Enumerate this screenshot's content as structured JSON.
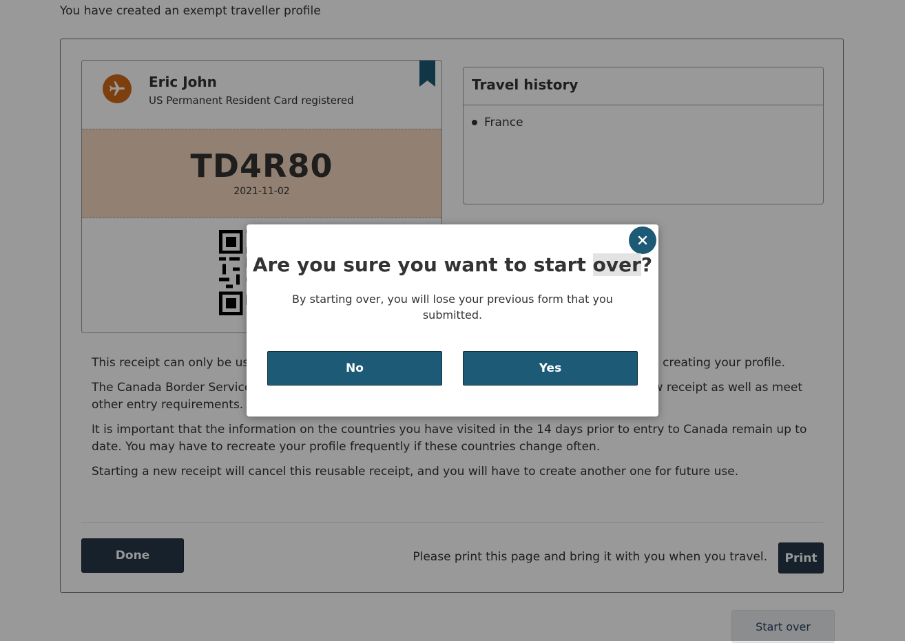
{
  "page": {
    "intro_text": "You have created an exempt traveller profile"
  },
  "receipt": {
    "traveller_name": "Eric John",
    "document_status": "US Permanent Resident Card registered",
    "receipt_code": "TD4R80",
    "receipt_date": "2021-11-02",
    "icons": {
      "traveller": "airplane-icon",
      "saved": "bookmark-icon",
      "code": "qr-code-icon"
    }
  },
  "travel_history": {
    "title": "Travel history",
    "countries": [
      "France"
    ]
  },
  "notes": [
    "This receipt can only be used for entry to Canada using the travel document you indicated when creating your profile.",
    "The Canada Border Services Agency may ask you to provide additional information, create a new receipt as well as meet other entry requirements.",
    "It is important that the information on the countries you have visited in the 14 days prior to entry to Canada remain up to date. You may have to recreate your profile frequently if these countries change often.",
    "Starting a new receipt will cancel this reusable receipt, and you will have to create another one for future use."
  ],
  "actions": {
    "done_label": "Done",
    "print_message": "Please print this page and bring it with you when you travel.",
    "print_label": "Print",
    "start_over_label": "Start over"
  },
  "modal": {
    "title_before": "Are you sure you want to start ",
    "title_highlight": "over",
    "title_after": "?",
    "body": "By starting over, you will lose your previous form that you submitted.",
    "no_label": "No",
    "yes_label": "Yes",
    "close_icon": "close-icon"
  },
  "colors": {
    "brand_dark": "#26374a",
    "modal_button": "#1d5a75",
    "accent_orange": "#d26a1a",
    "code_band": "#f4d7bf",
    "overlay": "rgba(0,0,0,0.40)"
  }
}
